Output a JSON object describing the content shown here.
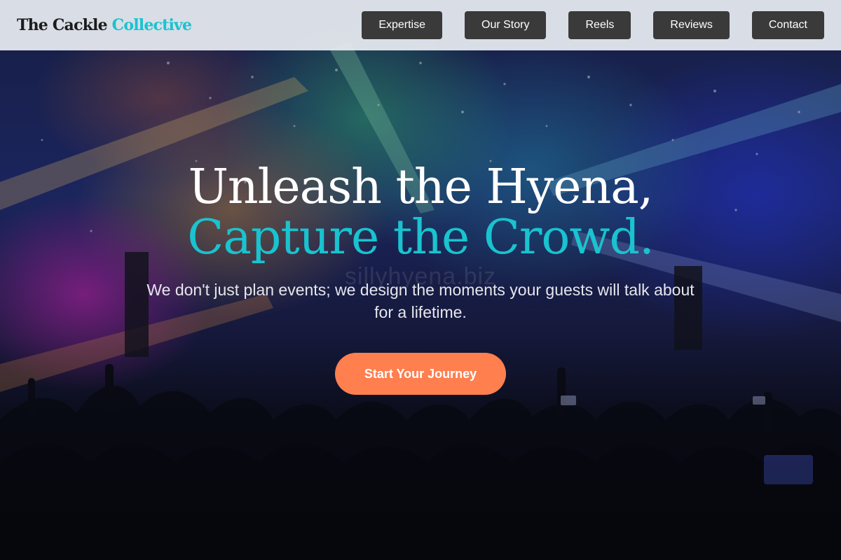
{
  "brand": {
    "name_primary": "The Cackle",
    "name_accent": "Collective"
  },
  "nav": {
    "items": [
      {
        "label": "Expertise"
      },
      {
        "label": "Our Story"
      },
      {
        "label": "Reels"
      },
      {
        "label": "Reviews"
      },
      {
        "label": "Contact"
      }
    ]
  },
  "hero": {
    "headline_line1": "Unleash the Hyena,",
    "headline_line2": "Capture the Crowd.",
    "subtext": "We don't just plan events; we design the moments your guests will talk about for a lifetime.",
    "cta_label": "Start Your Journey",
    "watermark": "sillyhyena.biz",
    "background_image": "concert-crowd-stage-lights"
  },
  "colors": {
    "accent_teal": "#19c3cf",
    "cta_orange": "#ff7f4f",
    "nav_button": "#3a3a3a",
    "nav_bar": "#e8ecf2"
  }
}
